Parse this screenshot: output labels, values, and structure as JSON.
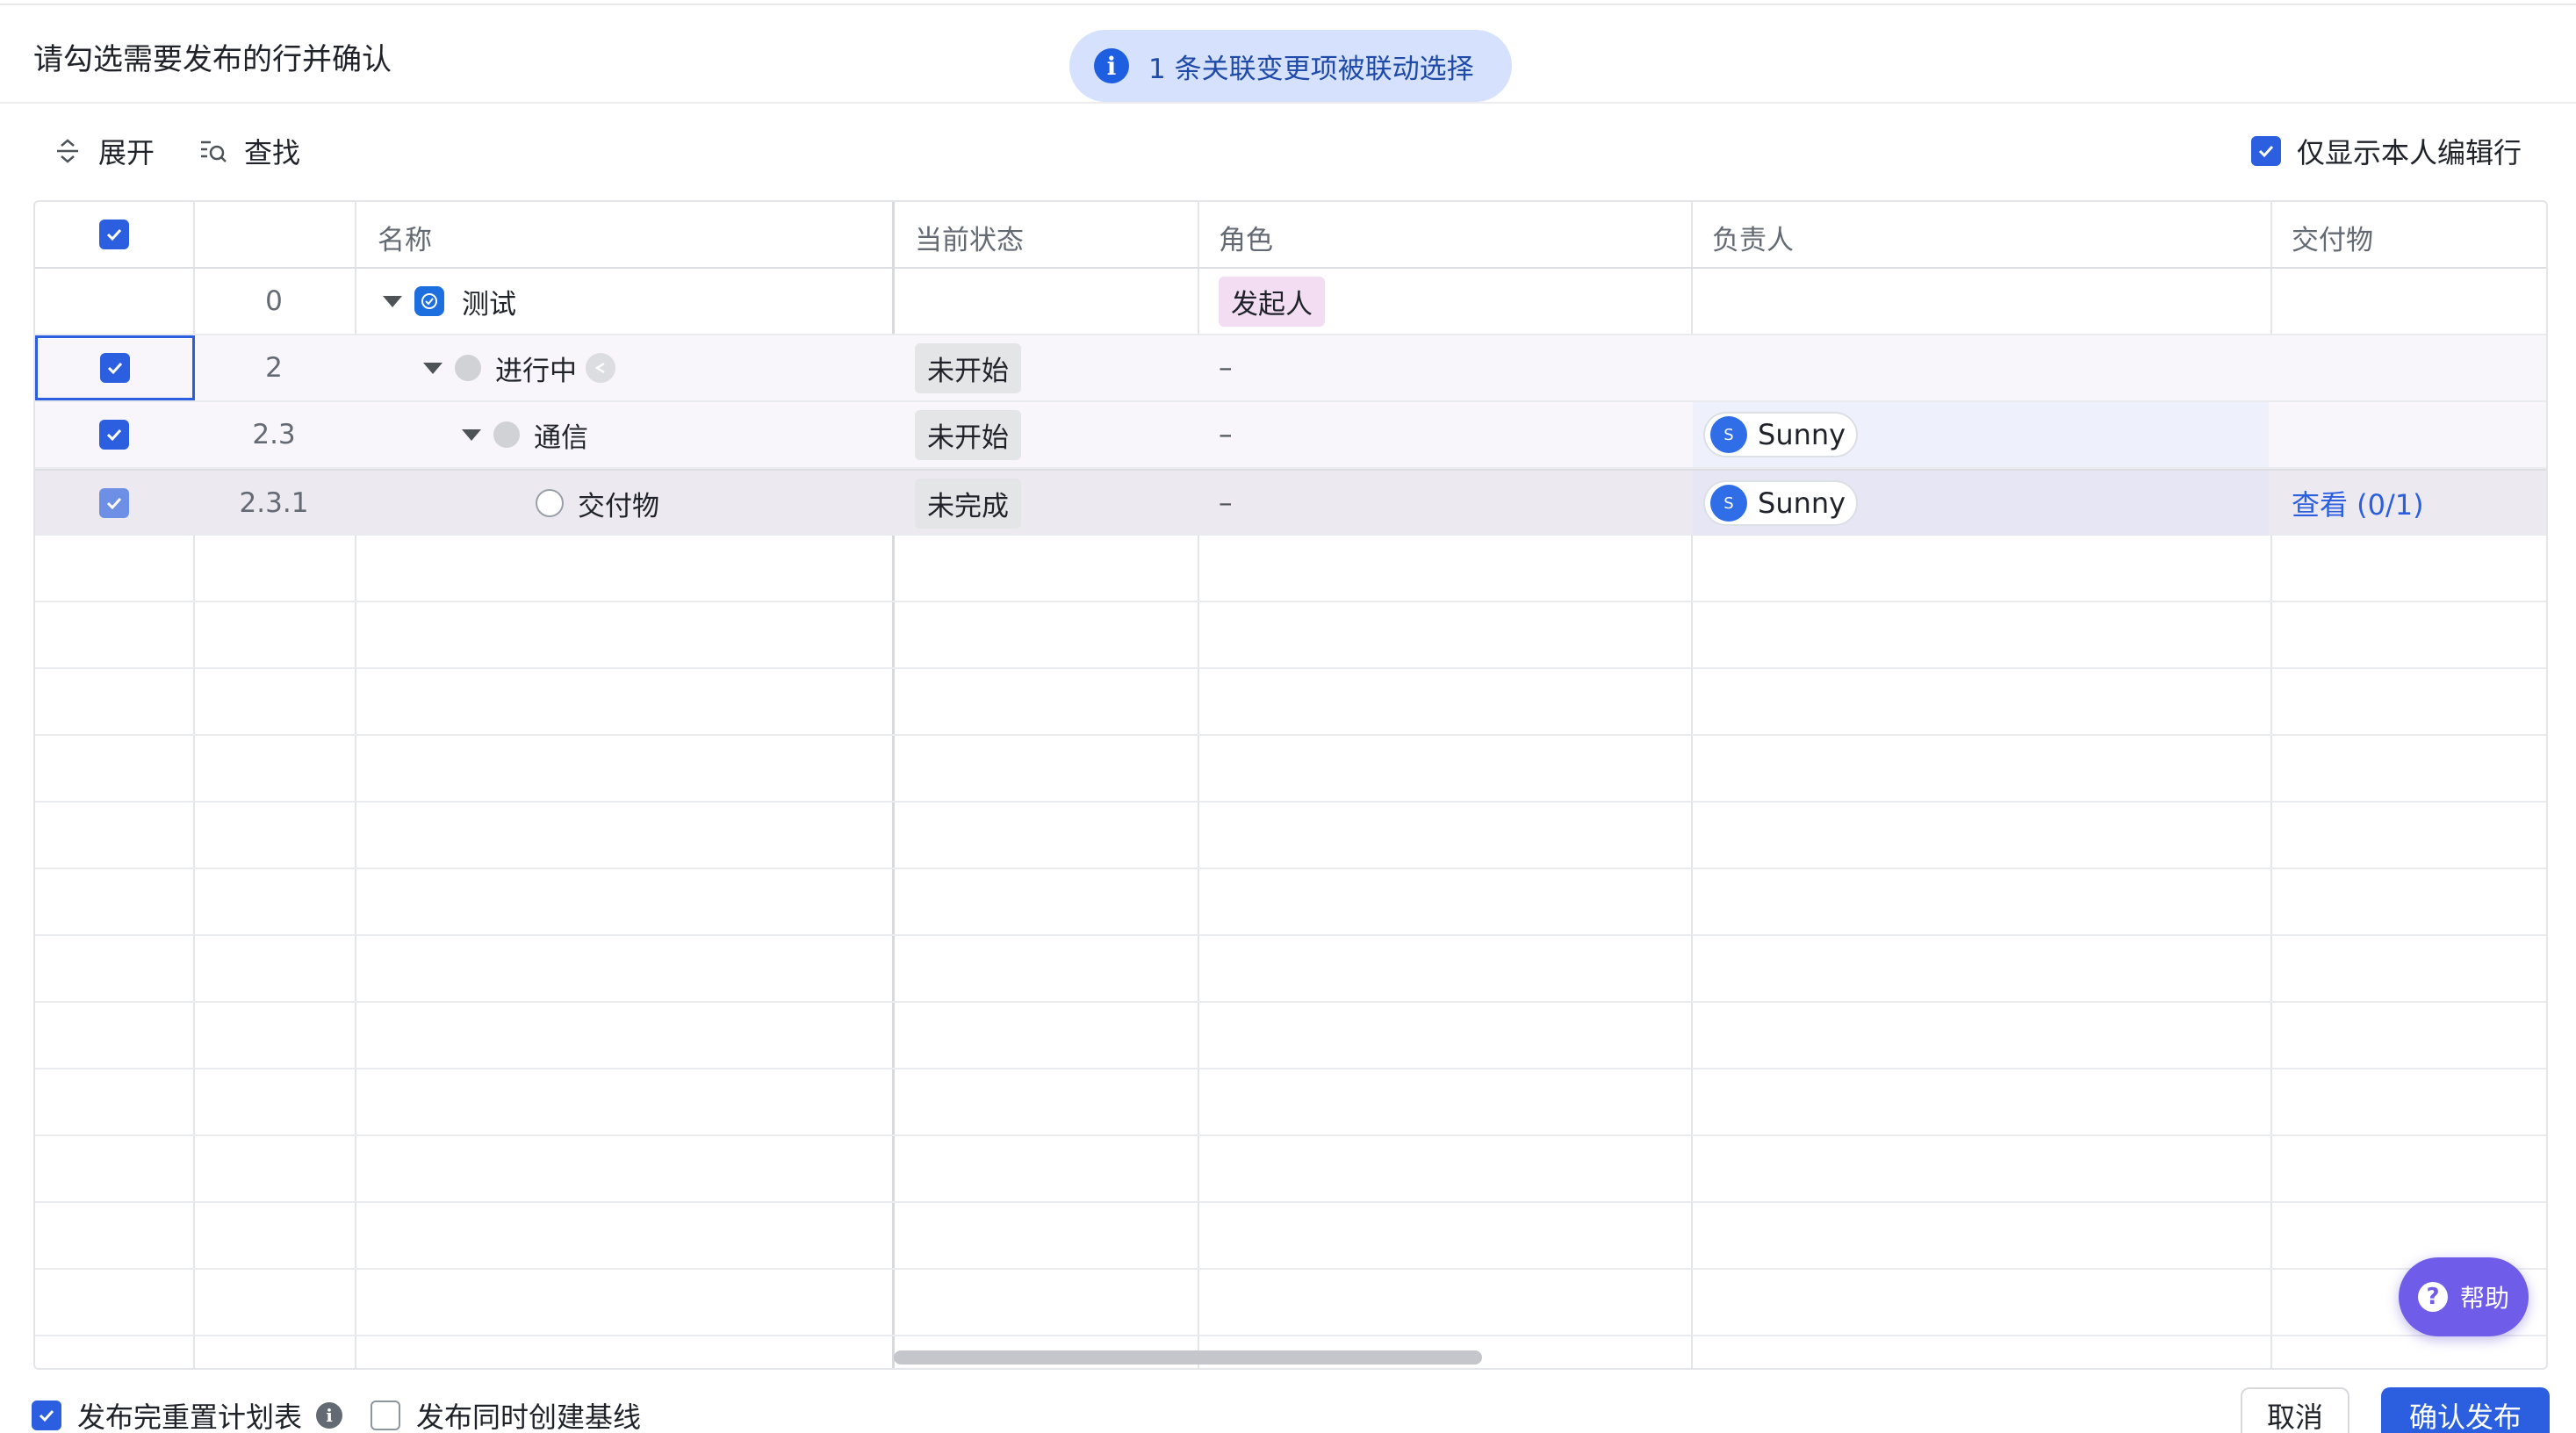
{
  "dialog": {
    "title": "请勾选需要发布的行并确认"
  },
  "toast": {
    "icon": "info-icon",
    "text": "1 条关联变更项被联动选择"
  },
  "toolbar": {
    "expand_label": "展开",
    "find_label": "查找",
    "only_mine_label": "仅显示本人编辑行",
    "only_mine_checked": true
  },
  "table": {
    "columns": [
      "名称",
      "当前状态",
      "角色",
      "负责人",
      "交付物"
    ],
    "header_checked": true,
    "rows": [
      {
        "checked": false,
        "number": "0",
        "name": "测试",
        "status": "",
        "role": "发起人",
        "owner": "",
        "owner_initial": "",
        "deliverable": ""
      },
      {
        "checked": true,
        "number": "2",
        "name": "进行中",
        "status": "未开始",
        "role": "–",
        "owner": "",
        "owner_initial": "",
        "deliverable": ""
      },
      {
        "checked": true,
        "number": "2.3",
        "name": "通信",
        "status": "未开始",
        "role": "–",
        "owner": "Sunny",
        "owner_initial": "S",
        "deliverable": ""
      },
      {
        "checked": true,
        "number": "2.3.1",
        "name": "交付物",
        "status": "未完成",
        "role": "–",
        "owner": "Sunny",
        "owner_initial": "S",
        "deliverable": "查看 (0/1)"
      }
    ]
  },
  "help": {
    "label": "帮助"
  },
  "footer": {
    "reset_plan_label": "发布完重置计划表",
    "reset_plan_checked": true,
    "baseline_label": "发布同时创建基线",
    "baseline_checked": false,
    "cancel_label": "取消",
    "confirm_label": "确认发布"
  },
  "colors": {
    "accent": "#2b5fe0",
    "toast_bg": "#d6e2fd",
    "help_bg": "#6f5ce8",
    "role_tag_bg": "#f3ddf2",
    "status_tag_bg": "#e4e5e7"
  }
}
